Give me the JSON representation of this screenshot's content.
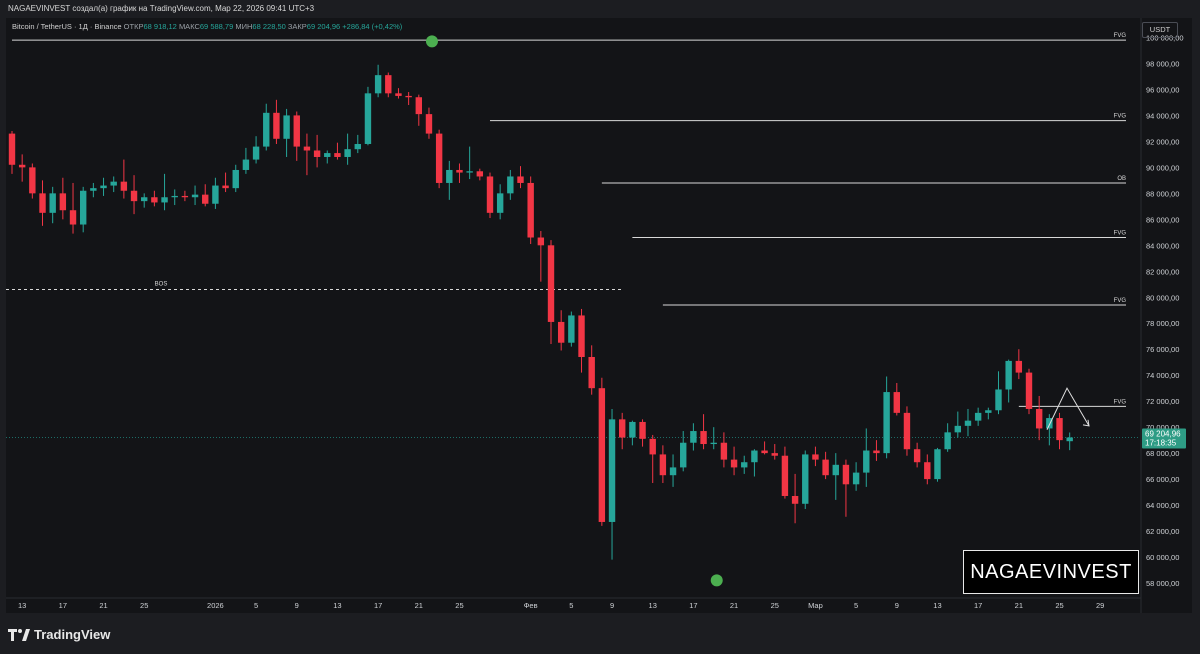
{
  "header": {
    "attribution": "NAGAEVINVEST создал(а) график на TradingView.com, Мар 22, 2026 09:41 UTC+3"
  },
  "legend": {
    "symbol": "Bitcoin / TetherUS · 1Д · Binance",
    "open_label": "ОТКР",
    "open_value": "68 918,12",
    "high_label": "МАКС",
    "high_value": "69 588,79",
    "low_label": "МИН",
    "low_value": "68 228,50",
    "close_label": "ЗАКР",
    "close_value": "69 204,96",
    "change": "+286,84 (+0,42%)"
  },
  "currency_button": "USDT",
  "footer": {
    "brand": "TradingView"
  },
  "watermark": "NAGAEVINVEST",
  "colors": {
    "up": "#26a69a",
    "down": "#f23645",
    "price_tag": "#2e9c85",
    "marker": "#4caf50",
    "accent_purple": "#9c27b0"
  },
  "chart_data": {
    "type": "candlestick",
    "ylim": [
      57000,
      101500
    ],
    "y_ticks": [
      58000,
      60000,
      62000,
      64000,
      66000,
      68000,
      70000,
      72000,
      74000,
      76000,
      78000,
      80000,
      82000,
      84000,
      86000,
      88000,
      90000,
      92000,
      94000,
      96000,
      98000,
      100000
    ],
    "y_tick_labels": [
      "58 000,00",
      "60 000,00",
      "62 000,00",
      "64 000,00",
      "66 000,00",
      "68 000,00",
      "70 000,00",
      "72 000,00",
      "74 000,00",
      "76 000,00",
      "78 000,00",
      "80 000,00",
      "82 000,00",
      "84 000,00",
      "86 000,00",
      "88 000,00",
      "90 000,00",
      "92 000,00",
      "94 000,00",
      "96 000,00",
      "98 000,00",
      "100 000,00"
    ],
    "x_tick_labels": [
      {
        "i": 1,
        "label": "13"
      },
      {
        "i": 5,
        "label": "17"
      },
      {
        "i": 9,
        "label": "21"
      },
      {
        "i": 13,
        "label": "25"
      },
      {
        "i": 20,
        "label": "2026"
      },
      {
        "i": 24,
        "label": "5"
      },
      {
        "i": 28,
        "label": "9"
      },
      {
        "i": 32,
        "label": "13"
      },
      {
        "i": 36,
        "label": "17"
      },
      {
        "i": 40,
        "label": "21"
      },
      {
        "i": 44,
        "label": "25"
      },
      {
        "i": 51,
        "label": "Фев"
      },
      {
        "i": 55,
        "label": "5"
      },
      {
        "i": 59,
        "label": "9"
      },
      {
        "i": 63,
        "label": "13"
      },
      {
        "i": 67,
        "label": "17"
      },
      {
        "i": 71,
        "label": "21"
      },
      {
        "i": 75,
        "label": "25"
      },
      {
        "i": 79,
        "label": "Мар"
      },
      {
        "i": 83,
        "label": "5"
      },
      {
        "i": 87,
        "label": "9"
      },
      {
        "i": 91,
        "label": "13"
      },
      {
        "i": 95,
        "label": "17"
      },
      {
        "i": 99,
        "label": "21"
      },
      {
        "i": 103,
        "label": "25"
      },
      {
        "i": 107,
        "label": "29"
      }
    ],
    "candles": [
      {
        "o": 92600,
        "h": 92800,
        "l": 89500,
        "c": 90200
      },
      {
        "o": 90200,
        "h": 91000,
        "l": 88900,
        "c": 90000
      },
      {
        "o": 90000,
        "h": 90300,
        "l": 87600,
        "c": 88000
      },
      {
        "o": 88000,
        "h": 89000,
        "l": 85500,
        "c": 86500
      },
      {
        "o": 86500,
        "h": 88500,
        "l": 85700,
        "c": 88000
      },
      {
        "o": 88000,
        "h": 89200,
        "l": 86000,
        "c": 86700
      },
      {
        "o": 86700,
        "h": 88800,
        "l": 84900,
        "c": 85600
      },
      {
        "o": 85600,
        "h": 88500,
        "l": 85000,
        "c": 88200
      },
      {
        "o": 88200,
        "h": 88800,
        "l": 87700,
        "c": 88400
      },
      {
        "o": 88400,
        "h": 89200,
        "l": 87800,
        "c": 88600
      },
      {
        "o": 88600,
        "h": 89300,
        "l": 88100,
        "c": 88900
      },
      {
        "o": 88900,
        "h": 90600,
        "l": 87600,
        "c": 88200
      },
      {
        "o": 88200,
        "h": 89400,
        "l": 86400,
        "c": 87400
      },
      {
        "o": 87400,
        "h": 88000,
        "l": 86900,
        "c": 87700
      },
      {
        "o": 87700,
        "h": 88200,
        "l": 87000,
        "c": 87300
      },
      {
        "o": 87300,
        "h": 89500,
        "l": 86700,
        "c": 87700
      },
      {
        "o": 87700,
        "h": 88300,
        "l": 87100,
        "c": 87800
      },
      {
        "o": 87800,
        "h": 88200,
        "l": 87400,
        "c": 87700
      },
      {
        "o": 87700,
        "h": 88600,
        "l": 87100,
        "c": 87900
      },
      {
        "o": 87900,
        "h": 88700,
        "l": 87000,
        "c": 87200
      },
      {
        "o": 87200,
        "h": 89200,
        "l": 86800,
        "c": 88600
      },
      {
        "o": 88600,
        "h": 89600,
        "l": 88100,
        "c": 88400
      },
      {
        "o": 88400,
        "h": 90200,
        "l": 88100,
        "c": 89800
      },
      {
        "o": 89800,
        "h": 91500,
        "l": 89500,
        "c": 90600
      },
      {
        "o": 90600,
        "h": 92400,
        "l": 90300,
        "c": 91600
      },
      {
        "o": 91600,
        "h": 94900,
        "l": 91300,
        "c": 94200
      },
      {
        "o": 94200,
        "h": 95200,
        "l": 91800,
        "c": 92200
      },
      {
        "o": 92200,
        "h": 94500,
        "l": 90800,
        "c": 94000
      },
      {
        "o": 94000,
        "h": 94300,
        "l": 90500,
        "c": 91600
      },
      {
        "o": 91600,
        "h": 92600,
        "l": 89400,
        "c": 91300
      },
      {
        "o": 91300,
        "h": 92500,
        "l": 90000,
        "c": 90800
      },
      {
        "o": 90800,
        "h": 91300,
        "l": 90300,
        "c": 91100
      },
      {
        "o": 91100,
        "h": 91900,
        "l": 90600,
        "c": 90800
      },
      {
        "o": 90800,
        "h": 92600,
        "l": 90200,
        "c": 91400
      },
      {
        "o": 91400,
        "h": 92500,
        "l": 91100,
        "c": 91800
      },
      {
        "o": 91800,
        "h": 96200,
        "l": 91700,
        "c": 95700
      },
      {
        "o": 95700,
        "h": 97900,
        "l": 95400,
        "c": 97100
      },
      {
        "o": 97100,
        "h": 97300,
        "l": 95400,
        "c": 95700
      },
      {
        "o": 95700,
        "h": 96100,
        "l": 95300,
        "c": 95500
      },
      {
        "o": 95500,
        "h": 95800,
        "l": 94800,
        "c": 95400
      },
      {
        "o": 95400,
        "h": 95600,
        "l": 93200,
        "c": 94100
      },
      {
        "o": 94100,
        "h": 94600,
        "l": 92200,
        "c": 92600
      },
      {
        "o": 92600,
        "h": 92900,
        "l": 88400,
        "c": 88800
      },
      {
        "o": 88800,
        "h": 90500,
        "l": 87500,
        "c": 89800
      },
      {
        "o": 89800,
        "h": 90300,
        "l": 88800,
        "c": 89600
      },
      {
        "o": 89600,
        "h": 91600,
        "l": 89100,
        "c": 89700
      },
      {
        "o": 89700,
        "h": 89900,
        "l": 89000,
        "c": 89300
      },
      {
        "o": 89300,
        "h": 89600,
        "l": 86100,
        "c": 86500
      },
      {
        "o": 86500,
        "h": 88700,
        "l": 86000,
        "c": 88000
      },
      {
        "o": 88000,
        "h": 89800,
        "l": 87500,
        "c": 89300
      },
      {
        "o": 89300,
        "h": 90100,
        "l": 88400,
        "c": 88800
      },
      {
        "o": 88800,
        "h": 89300,
        "l": 84100,
        "c": 84600
      },
      {
        "o": 84600,
        "h": 85100,
        "l": 81200,
        "c": 84000
      },
      {
        "o": 84000,
        "h": 84400,
        "l": 76400,
        "c": 78100
      },
      {
        "o": 78100,
        "h": 79000,
        "l": 75900,
        "c": 76500
      },
      {
        "o": 76500,
        "h": 78900,
        "l": 76200,
        "c": 78600
      },
      {
        "o": 78600,
        "h": 79100,
        "l": 74200,
        "c": 75400
      },
      {
        "o": 75400,
        "h": 76300,
        "l": 72500,
        "c": 73000
      },
      {
        "o": 73000,
        "h": 73800,
        "l": 62400,
        "c": 62700
      },
      {
        "o": 62700,
        "h": 71400,
        "l": 59800,
        "c": 70600
      },
      {
        "o": 70600,
        "h": 71100,
        "l": 68300,
        "c": 69200
      },
      {
        "o": 69200,
        "h": 70500,
        "l": 68600,
        "c": 70400
      },
      {
        "o": 70400,
        "h": 70600,
        "l": 68500,
        "c": 69100
      },
      {
        "o": 69100,
        "h": 69400,
        "l": 65700,
        "c": 67900
      },
      {
        "o": 67900,
        "h": 68600,
        "l": 65700,
        "c": 66300
      },
      {
        "o": 66300,
        "h": 67900,
        "l": 65400,
        "c": 66900
      },
      {
        "o": 66900,
        "h": 69700,
        "l": 66600,
        "c": 68800
      },
      {
        "o": 68800,
        "h": 70300,
        "l": 68200,
        "c": 69700
      },
      {
        "o": 69700,
        "h": 71000,
        "l": 68300,
        "c": 68700
      },
      {
        "o": 68700,
        "h": 70000,
        "l": 68300,
        "c": 68800
      },
      {
        "o": 68800,
        "h": 69600,
        "l": 66900,
        "c": 67500
      },
      {
        "o": 67500,
        "h": 68500,
        "l": 66300,
        "c": 66900
      },
      {
        "o": 66900,
        "h": 67800,
        "l": 66400,
        "c": 67300
      },
      {
        "o": 67300,
        "h": 68300,
        "l": 66200,
        "c": 68200
      },
      {
        "o": 68200,
        "h": 68900,
        "l": 67900,
        "c": 68000
      },
      {
        "o": 68000,
        "h": 68700,
        "l": 67500,
        "c": 67800
      },
      {
        "o": 67800,
        "h": 68500,
        "l": 64500,
        "c": 64700
      },
      {
        "o": 64700,
        "h": 66400,
        "l": 62600,
        "c": 64100
      },
      {
        "o": 64100,
        "h": 68200,
        "l": 63700,
        "c": 67900
      },
      {
        "o": 67900,
        "h": 68500,
        "l": 67000,
        "c": 67500
      },
      {
        "o": 67500,
        "h": 68100,
        "l": 66000,
        "c": 66300
      },
      {
        "o": 66300,
        "h": 68000,
        "l": 64400,
        "c": 67100
      },
      {
        "o": 67100,
        "h": 67500,
        "l": 63100,
        "c": 65600
      },
      {
        "o": 65600,
        "h": 67300,
        "l": 65100,
        "c": 66500
      },
      {
        "o": 66500,
        "h": 69900,
        "l": 65400,
        "c": 68200
      },
      {
        "o": 68200,
        "h": 69000,
        "l": 67400,
        "c": 68000
      },
      {
        "o": 68000,
        "h": 73900,
        "l": 67600,
        "c": 72700
      },
      {
        "o": 72700,
        "h": 73400,
        "l": 70900,
        "c": 71100
      },
      {
        "o": 71100,
        "h": 71600,
        "l": 67800,
        "c": 68300
      },
      {
        "o": 68300,
        "h": 68800,
        "l": 66900,
        "c": 67300
      },
      {
        "o": 67300,
        "h": 67900,
        "l": 65600,
        "c": 66000
      },
      {
        "o": 66000,
        "h": 68400,
        "l": 65800,
        "c": 68300
      },
      {
        "o": 68300,
        "h": 70300,
        "l": 68100,
        "c": 69600
      },
      {
        "o": 69600,
        "h": 71200,
        "l": 69200,
        "c": 70100
      },
      {
        "o": 70100,
        "h": 71400,
        "l": 69300,
        "c": 70500
      },
      {
        "o": 70500,
        "h": 71500,
        "l": 70100,
        "c": 71100
      },
      {
        "o": 71100,
        "h": 71500,
        "l": 70600,
        "c": 71300
      },
      {
        "o": 71300,
        "h": 74300,
        "l": 71000,
        "c": 72900
      },
      {
        "o": 72900,
        "h": 75200,
        "l": 71900,
        "c": 75100
      },
      {
        "o": 75100,
        "h": 76000,
        "l": 73700,
        "c": 74200
      },
      {
        "o": 74200,
        "h": 74500,
        "l": 71000,
        "c": 71400
      },
      {
        "o": 71400,
        "h": 72400,
        "l": 69000,
        "c": 69900
      },
      {
        "o": 69900,
        "h": 71000,
        "l": 68600,
        "c": 70700
      },
      {
        "o": 70700,
        "h": 71100,
        "l": 68300,
        "c": 69000
      },
      {
        "o": 68918,
        "h": 69589,
        "l": 68229,
        "c": 69205
      }
    ],
    "levels": [
      {
        "label": "FVG",
        "y": 99800,
        "from": 0
      },
      {
        "label": "FVG",
        "y": 93600,
        "from": 47
      },
      {
        "label": "OB",
        "y": 88800,
        "from": 58
      },
      {
        "label": "FVG",
        "y": 84600,
        "from": 61
      },
      {
        "label": "FVG",
        "y": 79400,
        "from": 64
      },
      {
        "label": "FVG",
        "y": 71600,
        "from": 121
      }
    ],
    "bos": {
      "label": "BOS",
      "y": 80600,
      "to": 61
    },
    "markers": [
      {
        "i": 41,
        "y": 99700
      },
      {
        "i": 69,
        "y": 58200
      }
    ],
    "last_price": 69204.96,
    "last_price_label": "69 204,96",
    "countdown": "17:18:35"
  }
}
